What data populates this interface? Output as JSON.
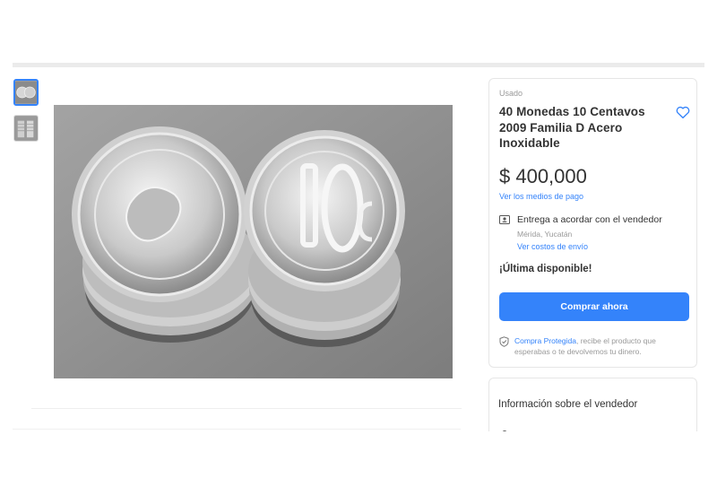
{
  "listing": {
    "condition": "Usado",
    "title": "40 Monedas 10 Centavos 2009 Familia D Acero Inoxidable",
    "price": "$ 400,000",
    "payment_link": "Ver los medios de pago",
    "shipping": {
      "text": "Entrega a acordar con el vendedor",
      "location": "Mérida, Yucatán",
      "costs_link": "Ver costos de envío"
    },
    "stock_note": "¡Última disponible!",
    "buy_button": "Comprar ahora",
    "protection": {
      "link": "Compra Protegida",
      "text": ", recibe el producto que esperabas o te devolvemos tu dinero."
    }
  },
  "seller": {
    "section_title": "Información sobre el vendedor"
  },
  "gallery": {
    "thumbnails": [
      "coins-top-view",
      "coins-side-view"
    ],
    "selected_index": 0
  },
  "colors": {
    "accent": "#3483fa",
    "text": "#333333",
    "muted": "#999999"
  }
}
